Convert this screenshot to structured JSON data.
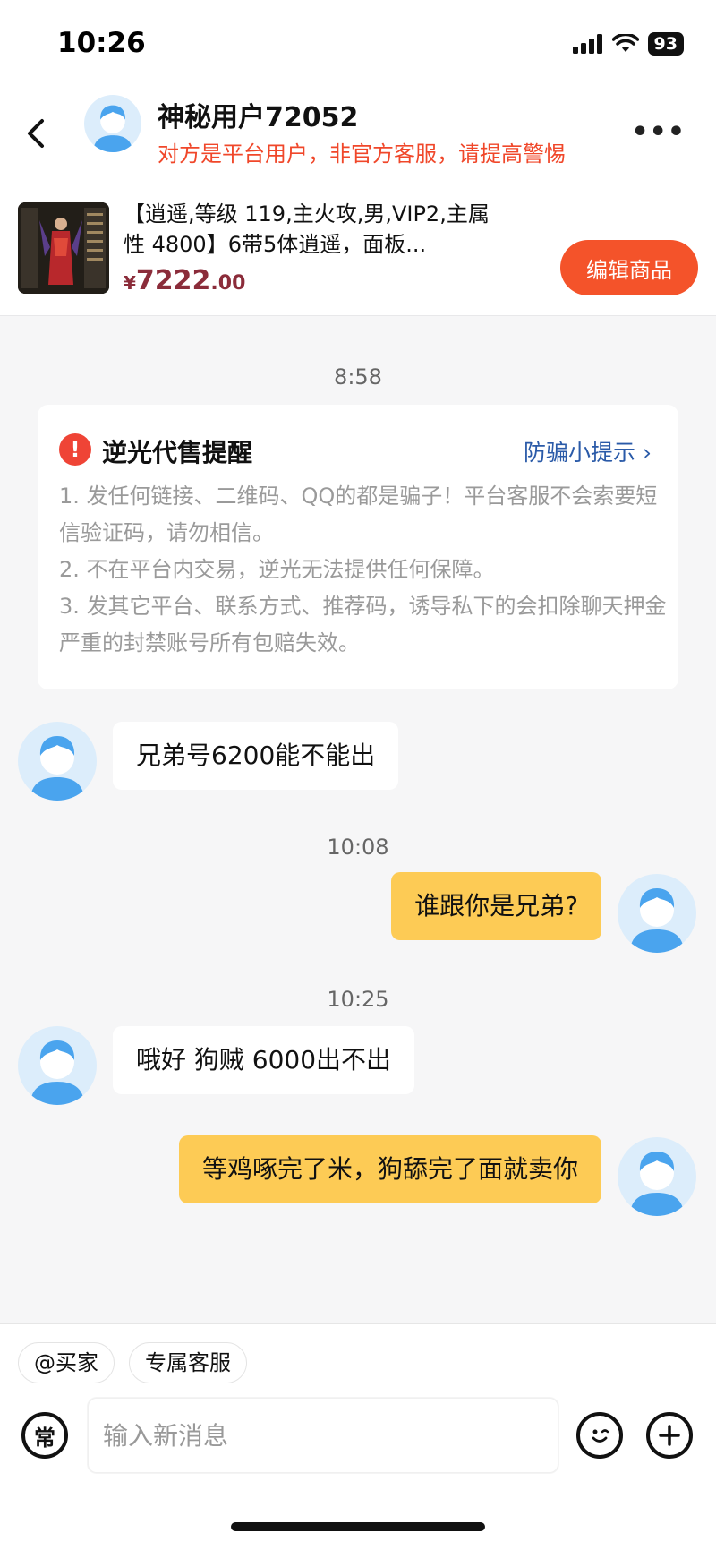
{
  "status_bar": {
    "time": "10:26",
    "battery": "93"
  },
  "header": {
    "name": "神秘用户72052",
    "warning": "对方是平台用户，非官方客服，请提高警惕"
  },
  "product": {
    "title": "【逍遥,等级 119,主火攻,男,VIP2,主属性 4800】6带5体逍遥，面板...",
    "price_symbol": "¥",
    "price_int": "7222",
    "price_dec": ".00",
    "edit_label": "编辑商品"
  },
  "notice": {
    "time": "8:58",
    "title": "逆光代售提醒",
    "link": "防骗小提示 ›",
    "lines": [
      "1. 发任何链接、二维码、QQ的都是骗子！平台客服不会索要短信验证码，请勿相信。",
      "2. 不在平台内交易，逆光无法提供任何保障。",
      "3. 发其它平台、联系方式、推荐码，诱导私下的会扣除聊天押金严重的封禁账号所有包赔失效。"
    ]
  },
  "messages": [
    {
      "side": "left",
      "text": "兄弟号6200能不能出"
    },
    {
      "time": "10:08"
    },
    {
      "side": "right",
      "text": "谁跟你是兄弟?"
    },
    {
      "time": "10:25"
    },
    {
      "side": "left",
      "text": "哦好 狗贼 6000出不出"
    },
    {
      "side": "right",
      "text": "等鸡啄完了米，狗舔完了面就卖你"
    }
  ],
  "quick_actions": [
    "@买家",
    "专属客服"
  ],
  "composer": {
    "common_label": "常",
    "placeholder": "输入新消息"
  },
  "colors": {
    "accent": "#f4532a",
    "warning_text": "#f0472a",
    "bubble_mine": "#fdcb55",
    "link": "#2a5aa8",
    "price": "#8b2c3a"
  }
}
